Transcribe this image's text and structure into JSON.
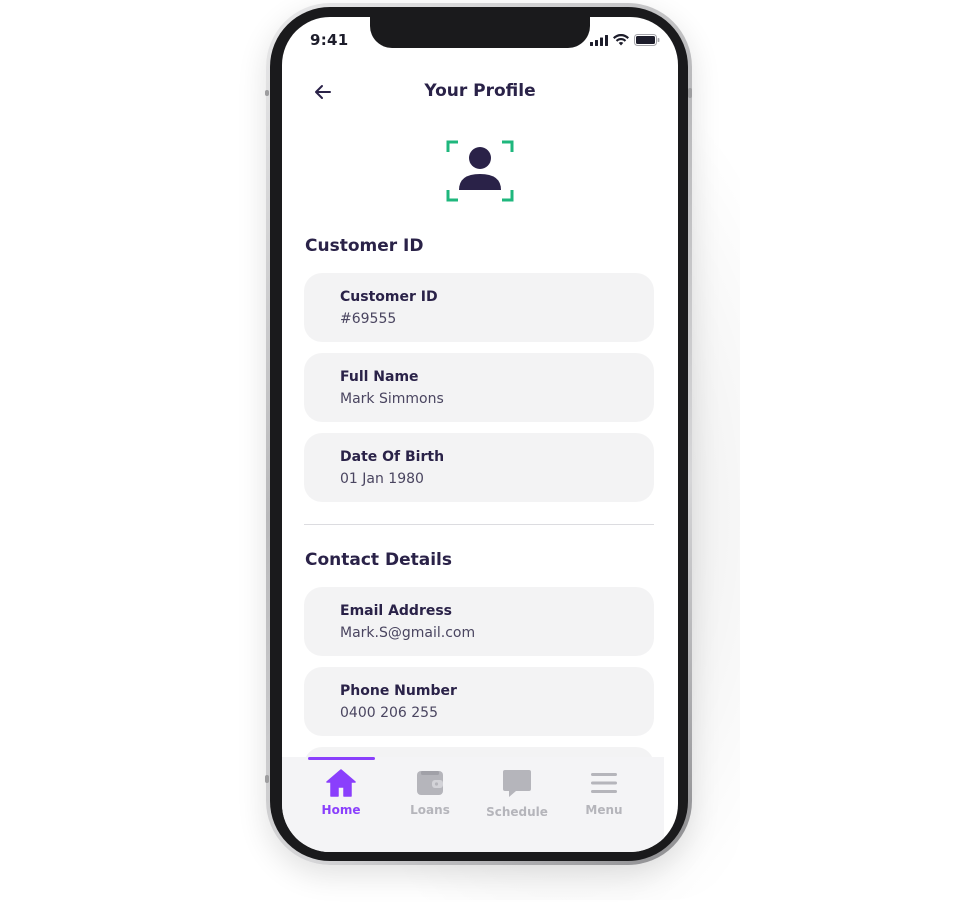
{
  "status_bar": {
    "time": "9:41"
  },
  "header": {
    "title": "Your Profile"
  },
  "sections": {
    "customer": {
      "title": "Customer ID",
      "fields": [
        {
          "label": "Customer ID",
          "value": "#69555"
        },
        {
          "label": "Full Name",
          "value": "Mark Simmons"
        },
        {
          "label": "Date Of Birth",
          "value": "01 Jan 1980"
        }
      ]
    },
    "contact": {
      "title": "Contact Details",
      "fields": [
        {
          "label": "Email Address",
          "value": "Mark.S@gmail.com"
        },
        {
          "label": "Phone Number",
          "value": "0400 206 255"
        }
      ]
    }
  },
  "tabbar": {
    "active": "Home",
    "tabs": [
      {
        "label": "Home",
        "icon": "home-icon"
      },
      {
        "label": "Loans",
        "icon": "wallet-icon"
      },
      {
        "label": "Schedule",
        "icon": "chat-icon"
      },
      {
        "label": "Menu",
        "icon": "menu-icon"
      }
    ]
  },
  "colors": {
    "accent": "#8a3ffc",
    "text_dark": "#2a2248",
    "avatar_frame": "#1fb77d",
    "card_bg": "#f3f3f4",
    "tab_inactive": "#b5b5bb"
  }
}
